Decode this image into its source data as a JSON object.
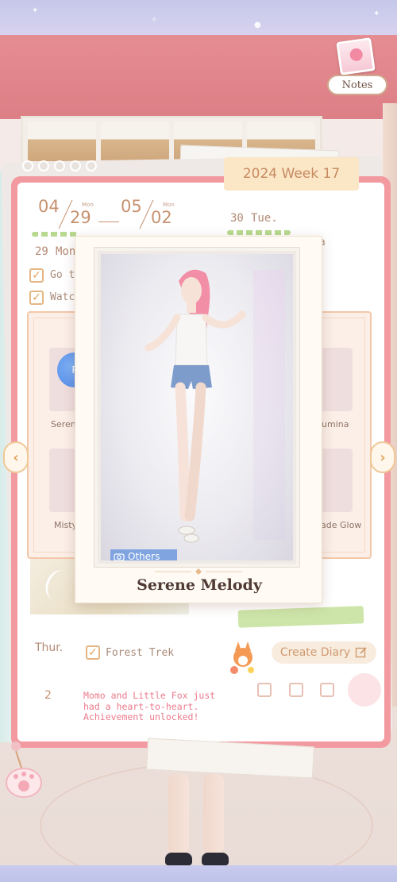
{
  "header": {
    "notes_label": "Notes"
  },
  "diary": {
    "week_label": "2024 Week 17",
    "date_range": {
      "start_month": "04",
      "start_day": "29",
      "start_weekday": "Mon",
      "end_month": "05",
      "end_day": "02",
      "end_weekday": "Mon"
    },
    "days": [
      {
        "num": "29",
        "name": "Mon"
      },
      {
        "num": "30",
        "name": "Tue."
      }
    ],
    "tasks_left": [
      {
        "text": "Go t",
        "checked": true
      },
      {
        "text": "Watc",
        "checked": true
      }
    ],
    "right_fragment": "na",
    "thursday": {
      "label": "Thur.",
      "task": "Forest Trek",
      "checked": true
    },
    "create_button": "Create Diary",
    "entry_number": "2",
    "achievement_text": "Momo and Little Fox just had a heart-to-heart. Achievement unlocked!"
  },
  "collection": {
    "items": [
      {
        "label": "Seren"
      },
      {
        "label": "umina"
      },
      {
        "label": "Misty"
      },
      {
        "label": "ade Glow"
      }
    ],
    "badge_text": "P"
  },
  "card": {
    "category_tag": "Others",
    "title": "Serene Melody"
  },
  "colors": {
    "diary_border": "#f29aa0",
    "accent_text": "#c79270",
    "pink_text": "#ec7a8c",
    "tag_blue": "#7fa4e0"
  }
}
